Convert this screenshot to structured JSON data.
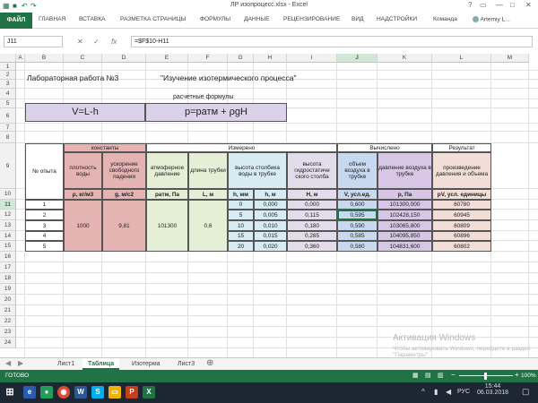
{
  "title_bar": {
    "title": "ЛР изопроцесс.xlsx - Excel",
    "window_controls": [
      "?",
      "▭",
      "—",
      "□",
      "✕"
    ]
  },
  "ribbon": {
    "tabs": [
      "ФАЙЛ",
      "ГЛАВНАЯ",
      "ВСТАВКА",
      "РАЗМЕТКА СТРАНИЦЫ",
      "ФОРМУЛЫ",
      "ДАННЫЕ",
      "РЕЦЕНЗИРОВАНИЕ",
      "ВИД",
      "НАДСТРОЙКИ",
      "Команда"
    ],
    "user": "Artemiy L..."
  },
  "formula_bar": {
    "name_box": "J11",
    "fx": "fx",
    "formula": "=$F$10-H11"
  },
  "columns": [
    "A",
    "B",
    "C",
    "D",
    "E",
    "F",
    "G",
    "H",
    "I",
    "J",
    "K",
    "L",
    "M"
  ],
  "selected_column": "J",
  "rows": [
    "1",
    "2",
    "3",
    "4",
    "5",
    "6",
    "7",
    "8",
    "9",
    "10",
    "11",
    "12",
    "13",
    "14",
    "15",
    "16",
    "17",
    "18",
    "19",
    "20",
    "21",
    "22",
    "23",
    "24"
  ],
  "selected_row": "11",
  "sheet": {
    "heading_left": "Лабораторная работа №3",
    "heading_right": "\"Изучение изотермического процесса\"",
    "formulas_label": "расчетные формулы",
    "formula_v": "V=L-h",
    "formula_p": "p=ратм + ρgH",
    "groups": {
      "constants": "константы",
      "measured": "Измерено",
      "computed": "Вычислено",
      "result": "Результат"
    },
    "exp_no": "№ опыта",
    "headers": {
      "density": "плотность воды",
      "gravity": "ускорение свободного падения",
      "atm": "атмоферное давление",
      "tube_len": "длина трубки",
      "col_height": "высота столбика воды в трубке",
      "hydro_height": "высота гидростатиче ского столба",
      "air_vol": "объем воздуха в трубке",
      "air_press": "давление воздуха в трубке",
      "product": "произведение давления и объема"
    },
    "units": {
      "density": "ρ, кг/м3",
      "gravity": "g, м/с2",
      "atm": "ратм, Па",
      "tube_len": "L, м",
      "h_mm": "h, мм",
      "h_m": "h, м",
      "H": "H, м",
      "V": "V, усл.ед.",
      "p": "р, Па",
      "pV": "pV, усл. единицы"
    },
    "constants": {
      "density": "1000",
      "gravity": "9,81",
      "atm": "101300",
      "tube_len": "0,6"
    },
    "data_rows": [
      {
        "n": "1",
        "h_mm": "0",
        "h_m": "0,000",
        "H": "0,000",
        "V": "0,600",
        "p": "101300,000",
        "pV": "60780"
      },
      {
        "n": "2",
        "h_mm": "5",
        "h_m": "0,005",
        "H": "0,115",
        "V": "0,595",
        "p": "102428,150",
        "pV": "60945"
      },
      {
        "n": "3",
        "h_mm": "10",
        "h_m": "0,010",
        "H": "0,180",
        "V": "0,590",
        "p": "103065,800",
        "pV": "60809"
      },
      {
        "n": "4",
        "h_mm": "15",
        "h_m": "0,015",
        "H": "0,285",
        "V": "0,585",
        "p": "104095,850",
        "pV": "60896"
      },
      {
        "n": "5",
        "h_mm": "20",
        "h_m": "0,020",
        "H": "0,360",
        "V": "0,580",
        "p": "104831,600",
        "pV": "60802"
      }
    ]
  },
  "sheet_tabs": [
    "Лист1",
    "Таблица",
    "Изотерма",
    "Лист3"
  ],
  "active_sheet_tab": "Таблица",
  "status": {
    "ready": "ГОТОВО",
    "zoom": "100%"
  },
  "watermark": {
    "line1": "Активация Windows",
    "line2": "Чтобы активировать Windows, перейдите в раздел \"Параметры\"."
  },
  "taskbar": {
    "lang": "РУС",
    "time": "15:44",
    "date": "06.03.2018"
  },
  "colors": {
    "excel_green": "#217346",
    "constants_fill": "#e6b3b3",
    "measured_fill": "#e4efd6",
    "height_fill": "#d6ecf2",
    "hydro_fill": "#e3dcea",
    "volume_fill": "#c7d9ef",
    "pressure_fill": "#d7c6e6",
    "result_fill": "#f2ddd7",
    "formula_fill": "#d9d2e9"
  }
}
